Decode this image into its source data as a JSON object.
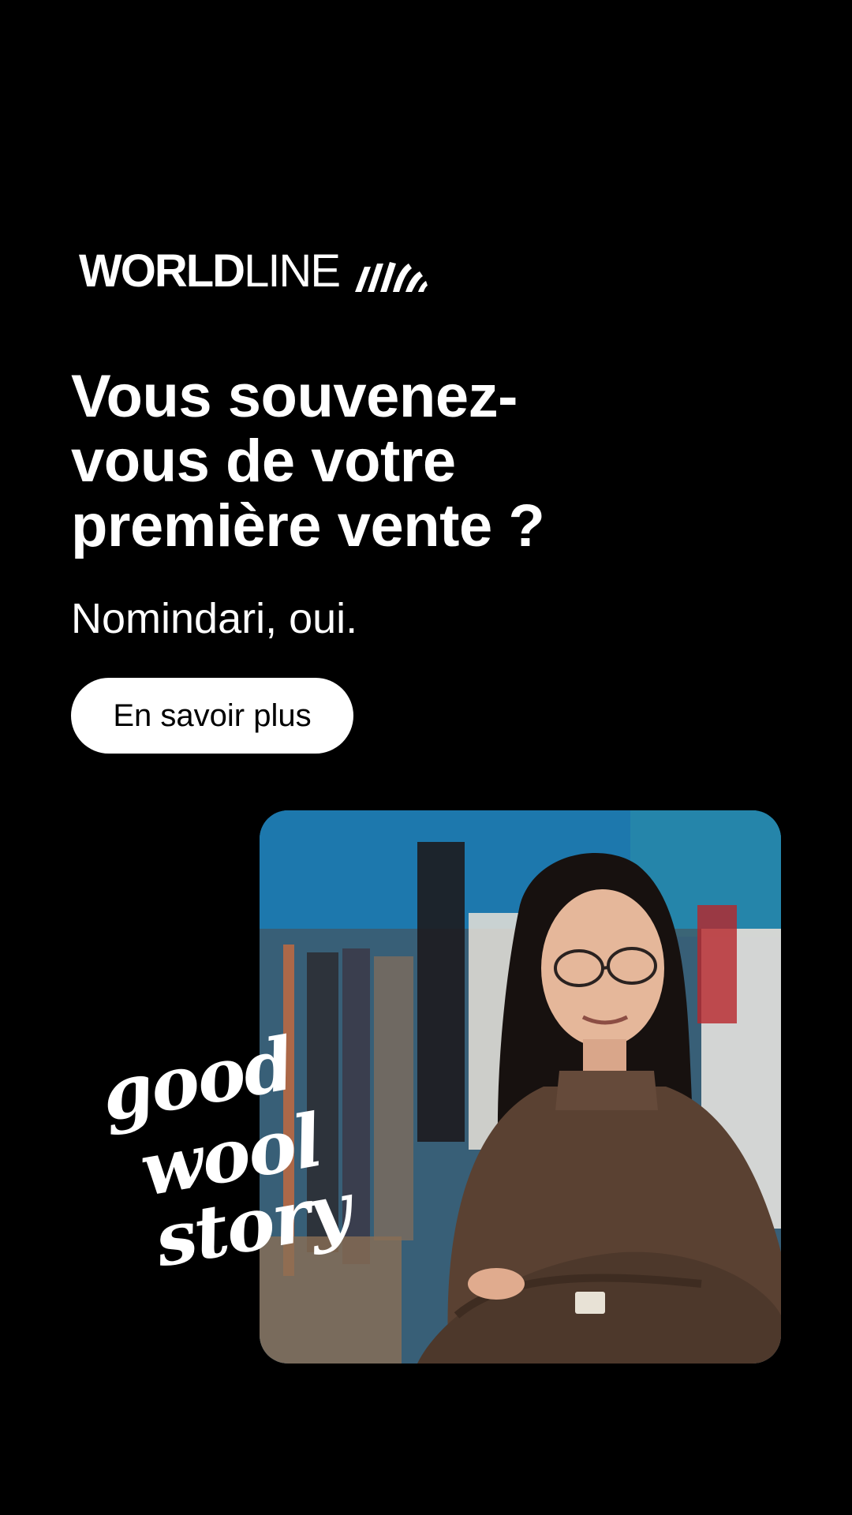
{
  "brand": {
    "name_bold": "WORLD",
    "name_light": "LINE",
    "logo_icon": "worldline-wave-icon"
  },
  "headline": "Vous souvenez-\nvous de votre\npremière vente ?",
  "subline": "Nomindari, oui.",
  "cta": {
    "label": "En savoir plus"
  },
  "script_logo": {
    "line1": "good",
    "line2": "wool",
    "line3": "story"
  },
  "photo": {
    "subject": "portrait-photo"
  },
  "colors": {
    "background": "#000000",
    "text": "#ffffff",
    "button_bg": "#ffffff",
    "button_text": "#000000"
  }
}
